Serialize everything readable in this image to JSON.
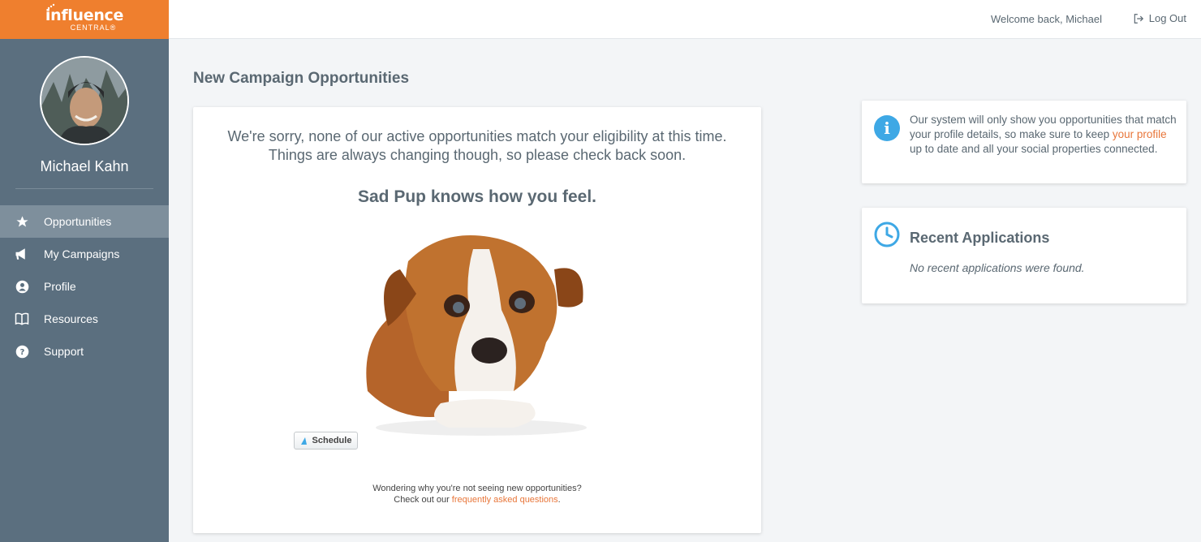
{
  "brand": {
    "name": "influence",
    "sub": "CENTRAL®",
    "color": "#ef7f2e"
  },
  "user": {
    "name": "Michael Kahn"
  },
  "sidebar": {
    "items": [
      {
        "label": "Opportunities",
        "icon": "star-icon",
        "active": true
      },
      {
        "label": "My Campaigns",
        "icon": "megaphone-icon"
      },
      {
        "label": "Profile",
        "icon": "user-circle-icon"
      },
      {
        "label": "Resources",
        "icon": "book-icon"
      },
      {
        "label": "Support",
        "icon": "question-circle-icon"
      }
    ]
  },
  "header": {
    "welcome": "Welcome back, Michael",
    "logout": "Log Out"
  },
  "main": {
    "title": "New Campaign Opportunities",
    "message_line1": "We're sorry, none of our active opportunities match your eligibility at this time.",
    "message_line2": "Things are always changing though, so please check back soon.",
    "sad_title": "Sad Pup knows how you feel.",
    "schedule_label": "Schedule",
    "faq_line1": "Wondering why you're not seeing new opportunities?",
    "faq_prefix": "Check out our ",
    "faq_link": "frequently asked questions",
    "faq_suffix": "."
  },
  "info": {
    "text_before": "Our system will only show you opportunities that match your profile details, so make sure to keep ",
    "link": "your profile",
    "text_after": " up to date and all your social properties connected."
  },
  "recent": {
    "title": "Recent Applications",
    "empty": "No recent applications were found."
  },
  "colors": {
    "accent": "#e8763a",
    "sidebar": "#5b6f7f",
    "info_blue": "#3ea8e5"
  }
}
